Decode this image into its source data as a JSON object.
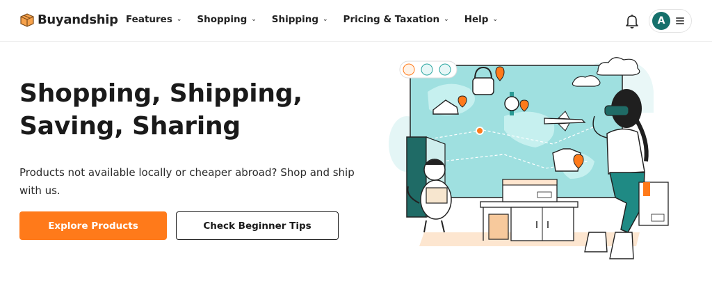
{
  "header": {
    "brand": "Buyandship",
    "nav": [
      {
        "label": "Features"
      },
      {
        "label": "Shopping"
      },
      {
        "label": "Shipping"
      },
      {
        "label": "Pricing & Taxation"
      },
      {
        "label": "Help"
      }
    ],
    "avatar_initial": "A"
  },
  "hero": {
    "title_line1": "Shopping, Shipping,",
    "title_line2": "Saving, Sharing",
    "subtitle": "Products not available locally or cheaper abroad? Shop and ship with us.",
    "primary_button": "Explore Products",
    "secondary_button": "Check Beginner Tips"
  },
  "colors": {
    "accent": "#ff7a1a",
    "avatar": "#15706b",
    "map": "#9fe0e0",
    "text": "#1a1a1a"
  },
  "icons": [
    "logo-box-icon",
    "chevron-down-icon",
    "bell-icon",
    "menu-icon"
  ]
}
